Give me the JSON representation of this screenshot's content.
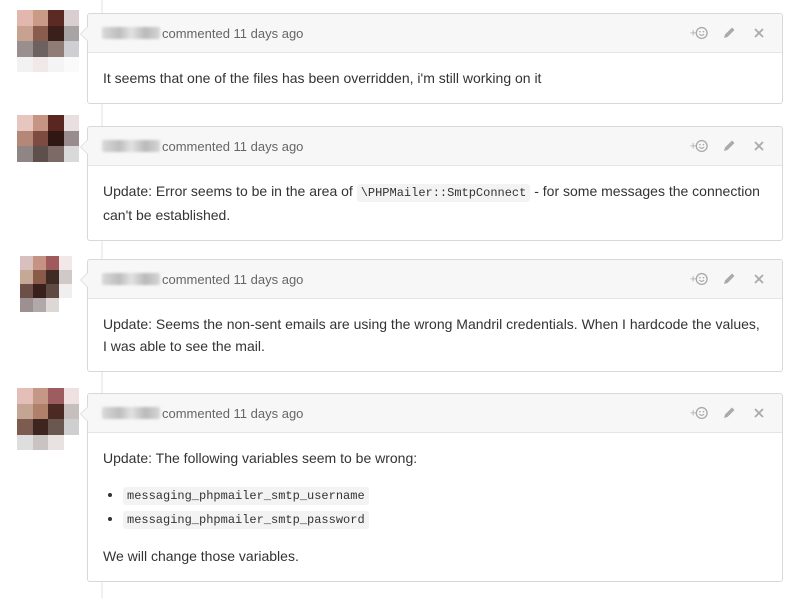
{
  "comments": [
    {
      "meta": "commented 11 days ago",
      "avatar_colors": [
        "#e2b8ae",
        "#c99a86",
        "#5b2a24",
        "#d9cfd0",
        "#c7a290",
        "#8a5c4d",
        "#3b1f1a",
        "#a8a4a6",
        "#9a8f8e",
        "#6d625f",
        "#8f7c74",
        "#cfcfd1",
        "#f2f2f2",
        "#f0e9e7",
        "#f4f4f4",
        "#fafafa"
      ],
      "text": "It seems that one of the files has been overridden, i'm still working on it"
    },
    {
      "meta": "commented 11 days ago",
      "avatar_colors": [
        "#e7c6bf",
        "#c59483",
        "#5a2620",
        "#eadfe0",
        "#b58776",
        "#7d4b3f",
        "#2f1714",
        "#9a8c8c",
        "#8e8584",
        "#5e4f4c",
        "#7b6a65",
        "#d9d9d9",
        "#ffffff",
        "#ffffff",
        "#ffffff",
        "#ffffff"
      ],
      "text_before": "Update: Error seems to be in the area of ",
      "code": "\\PHPMailer::SmtpConnect",
      "text_after": " - for some messages the connection can't be established."
    },
    {
      "meta": "commented 11 days ago",
      "avatar_colors": [
        "#d8c0bf",
        "#c59284",
        "#a05a5c",
        "#f3e8e8",
        "#c6a896",
        "#8a5b48",
        "#3e2b24",
        "#cfc9c9",
        "#6c5048",
        "#3a201c",
        "#5e4a40",
        "#f1eeee",
        "#9c9090",
        "#b1a9a7",
        "#ddd8d5",
        "#ffffff"
      ],
      "text": "Update: Seems the non-sent emails are using the wrong Mandril credentials. When I hardcode the values, I was able to see the mail."
    },
    {
      "meta": "commented 11 days ago",
      "avatar_colors": [
        "#e4bfb8",
        "#c49786",
        "#9c5c60",
        "#efe1e1",
        "#c4a593",
        "#b0806b",
        "#4a2a23",
        "#c7bebe",
        "#7e5b51",
        "#3d2520",
        "#6a5850",
        "#cfcfcf",
        "#dedede",
        "#c9c4c2",
        "#e8e3e1",
        "#ffffff"
      ],
      "text_intro": "Update: The following variables seem to be wrong:",
      "list": [
        "messaging_phpmailer_smtp_username",
        "messaging_phpmailer_smtp_password"
      ],
      "text_outro": "We will change those variables."
    }
  ],
  "icons": {
    "add_reaction": "add-reaction-icon",
    "edit": "pencil-icon",
    "delete": "close-icon"
  },
  "colors": {
    "header_bg": "#f7f7f7",
    "border": "#d8d8d8",
    "icon": "#999999"
  }
}
